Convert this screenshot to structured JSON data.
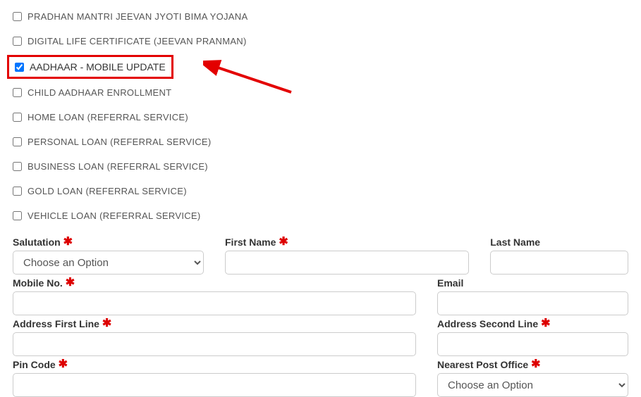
{
  "checkboxes": [
    {
      "label": "PRADHAN MANTRI JEEVAN JYOTI BIMA YOJANA",
      "checked": false
    },
    {
      "label": "DIGITAL LIFE CERTIFICATE (JEEVAN PRANMAN)",
      "checked": false
    },
    {
      "label": "AADHAAR - MOBILE UPDATE",
      "checked": true
    },
    {
      "label": "CHILD AADHAAR ENROLLMENT",
      "checked": false
    },
    {
      "label": "HOME LOAN (REFERRAL SERVICE)",
      "checked": false
    },
    {
      "label": "PERSONAL LOAN (REFERRAL SERVICE)",
      "checked": false
    },
    {
      "label": "BUSINESS LOAN (REFERRAL SERVICE)",
      "checked": false
    },
    {
      "label": "GOLD LOAN (REFERRAL SERVICE)",
      "checked": false
    },
    {
      "label": "VEHICLE LOAN (REFERRAL SERVICE)",
      "checked": false
    }
  ],
  "form": {
    "salutation": {
      "label": "Salutation",
      "required": true,
      "placeholder": "Choose an Option"
    },
    "first_name": {
      "label": "First Name",
      "required": true
    },
    "last_name": {
      "label": "Last Name",
      "required": false
    },
    "mobile_no": {
      "label": "Mobile No.",
      "required": true
    },
    "email": {
      "label": "Email",
      "required": false
    },
    "address1": {
      "label": "Address First Line",
      "required": true
    },
    "address2": {
      "label": "Address Second Line",
      "required": true
    },
    "pincode": {
      "label": "Pin Code",
      "required": true
    },
    "nearest_po": {
      "label": "Nearest Post Office",
      "required": true,
      "placeholder": "Choose an Option"
    }
  },
  "required_mark": "✱"
}
